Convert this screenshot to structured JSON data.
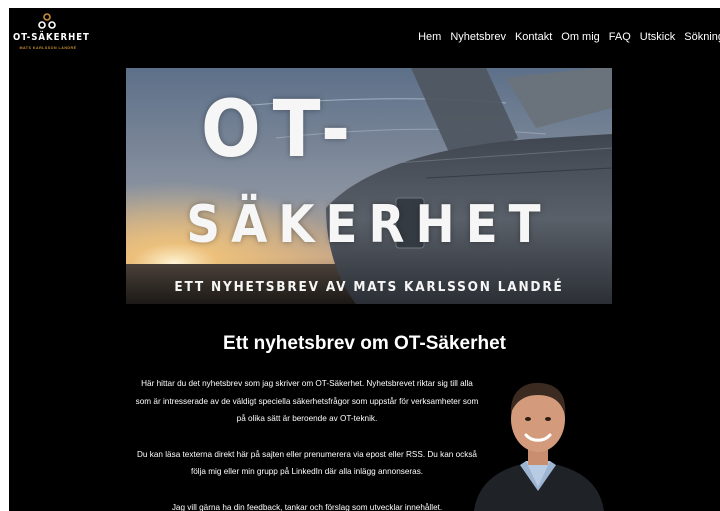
{
  "logo": {
    "title": "OT-SÄKERHET",
    "subtitle": "MATS KARLSSON LANDRÉ",
    "accent": "#c8902e"
  },
  "nav": {
    "items": [
      "Hem",
      "Nyhetsbrev",
      "Kontakt",
      "Om mig",
      "FAQ",
      "Utskick",
      "Sökning"
    ]
  },
  "hero": {
    "line1": "OT-",
    "line2": "SÄKERHET",
    "tagline": "ETT NYHETSBREV AV MATS KARLSSON LANDRÉ"
  },
  "main": {
    "headline": "Ett nyhetsbrev om OT-Säkerhet",
    "paragraphs": [
      "Här hittar du det nyhetsbrev som jag skriver om OT-Säkerhet. Nyhetsbrevet riktar sig till alla som är intresserade av de väldigt speciella säkerhetsfrågor som uppstår för verksamheter som på olika sätt är beroende av OT-teknik.",
      "Du kan läsa texterna direkt här på sajten eller prenumerera via epost eller RSS. Du kan också följa mig eller min grupp på LinkedIn där alla inlägg annonseras.",
      "Jag vill gärna ha din feedback, tankar och förslag som utvecklar innehållet."
    ]
  }
}
